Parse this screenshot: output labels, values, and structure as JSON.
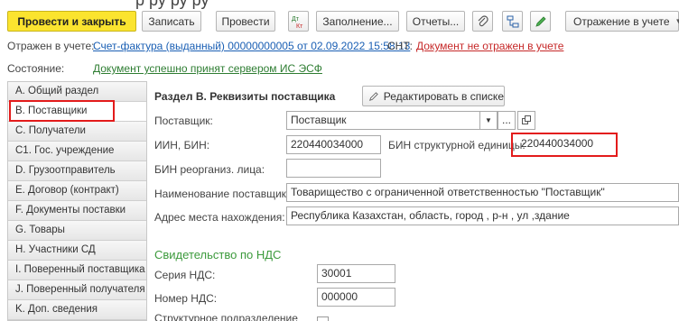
{
  "window": {
    "title_fragment": "р                ру ру ру"
  },
  "toolbar": {
    "post_close": "Провести и закрыть",
    "save": "Записать",
    "post": "Провести",
    "dtkt_icon": "dt-kt-icon",
    "fill": "Заполнение...",
    "reports": "Отчеты...",
    "accounting": "Отражение в учете"
  },
  "status": {
    "reflected_label": "Отражен в учете:",
    "invoice_link": "Счет-фактура (выданный) 00000000005 от 02.09.2022 15:58:13",
    "cnt_label": "СНТ:",
    "cnt_link": "Документ не отражен в учете",
    "state_label": "Состояние:",
    "state_link": "Документ успешно принят сервером ИС ЭСФ"
  },
  "sidebar": {
    "items": [
      {
        "label": "А. Общий раздел"
      },
      {
        "label": "В. Поставщики"
      },
      {
        "label": "С. Получатели"
      },
      {
        "label": "С1. Гос. учреждение"
      },
      {
        "label": "D. Грузоотправитель"
      },
      {
        "label": "E. Договор (контракт)"
      },
      {
        "label": "F. Документы поставки"
      },
      {
        "label": "G. Товары"
      },
      {
        "label": "H. Участники СД"
      },
      {
        "label": "I. Поверенный поставщика"
      },
      {
        "label": "J. Поверенный получателя"
      },
      {
        "label": "K. Доп. сведения"
      }
    ]
  },
  "section": {
    "title": "Раздел В. Реквизиты поставщика",
    "edit_list": "Редактировать в списке",
    "supplier_label": "Поставщик:",
    "supplier_value": "Поставщик",
    "iin_label": "ИИН, БИН:",
    "iin_value": "220440034000",
    "bin_struct_label": "БИН структурной единицы:",
    "bin_struct_value": "220440034000",
    "bin_reorg_label": "БИН реорганиз. лица:",
    "bin_reorg_value": "",
    "name_label": "Наименование поставщика:",
    "name_value": "Товарищество с ограниченной ответственностью \"Поставщик\"",
    "address_label": "Адрес места нахождения:",
    "address_value": "Республика Казахстан,  область, город , р-н , ул ,здание",
    "vat_heading": "Свидетельство по НДС",
    "vat_series_label": "Серия НДС:",
    "vat_series_value": "30001",
    "vat_number_label": "Номер НДС:",
    "vat_number_value": "000000",
    "struct_unit_label": "Структурное подразделение"
  },
  "colors": {
    "primary": "#fbe42f",
    "link": "#1a5fb4",
    "error": "#c62828",
    "success": "#2e7d32",
    "highlight": "#e31b1b"
  }
}
